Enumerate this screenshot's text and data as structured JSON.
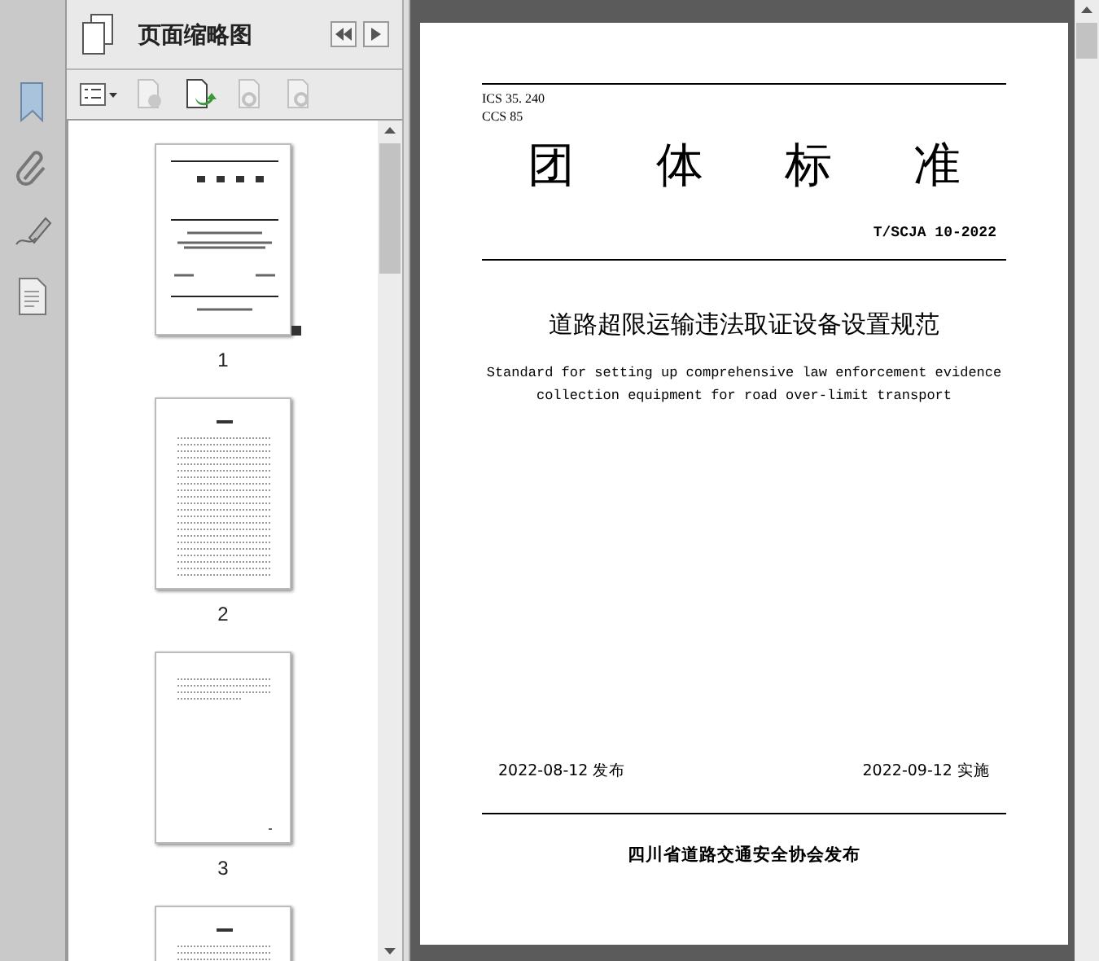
{
  "panel": {
    "title": "页面缩略图"
  },
  "thumbnails": [
    {
      "label": "1",
      "kind": "cover",
      "selected": true
    },
    {
      "label": "2",
      "kind": "contents",
      "selected": false
    },
    {
      "label": "3",
      "kind": "short",
      "selected": false
    },
    {
      "kind": "contents",
      "selected": false
    }
  ],
  "document": {
    "ics": "ICS 35. 240",
    "ccs": "CCS 85",
    "heading_chars": [
      "团",
      "体",
      "标",
      "准"
    ],
    "number": "T/SCJA 10-2022",
    "title": "道路超限运输违法取证设备设置规范",
    "subtitle_lines": [
      "Standard for setting up comprehensive law enforcement evidence",
      "collection equipment for road over-limit transport"
    ],
    "issue_date": "2022-08-12 发布",
    "effective_date": "2022-09-12 实施",
    "publisher": "四川省道路交通安全协会发布"
  }
}
